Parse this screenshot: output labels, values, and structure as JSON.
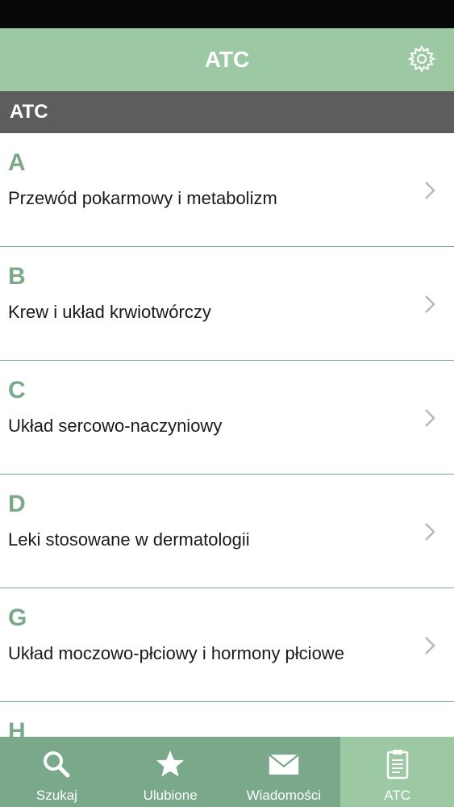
{
  "header": {
    "title": "ATC",
    "settings_icon": "gear-icon"
  },
  "section": {
    "title": "ATC"
  },
  "list": {
    "items": [
      {
        "letter": "A",
        "label": "Przewód pokarmowy i metabolizm"
      },
      {
        "letter": "B",
        "label": "Krew i układ krwiotwórczy"
      },
      {
        "letter": "C",
        "label": "Układ sercowo-naczyniowy"
      },
      {
        "letter": "D",
        "label": "Leki stosowane w dermatologii"
      },
      {
        "letter": "G",
        "label": "Układ moczowo-płciowy i hormony płciowe"
      },
      {
        "letter": "H",
        "label": ""
      }
    ]
  },
  "tabs": [
    {
      "label": "Szukaj",
      "icon": "search-icon"
    },
    {
      "label": "Ulubione",
      "icon": "star-icon"
    },
    {
      "label": "Wiadomości",
      "icon": "envelope-icon"
    },
    {
      "label": "ATC",
      "icon": "clipboard-icon",
      "active": true
    }
  ],
  "colors": {
    "nav_bar": "#9cc9a4",
    "section_header": "#5d5d5d",
    "tab_bar": "#79a88a",
    "tab_active": "#9cc9a4",
    "letter": "#79a88a",
    "status_bar": "#070608"
  }
}
